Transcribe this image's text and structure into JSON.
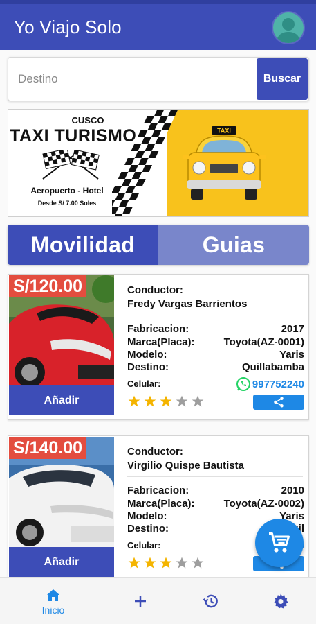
{
  "app": {
    "title": "Yo Viajo Solo"
  },
  "search": {
    "placeholder": "Destino",
    "button_label": "Buscar"
  },
  "banner": {
    "city": "CUSCO",
    "headline": "TAXI TURISMO",
    "subtitle": "Aeropuerto - Hotel",
    "price_note": "Desde S/ 7.00 Soles",
    "taxi_sign": "TAXI"
  },
  "tabs": [
    {
      "label": "Movilidad",
      "active": true
    },
    {
      "label": "Guias",
      "active": false
    }
  ],
  "labels": {
    "driver": "Conductor:",
    "year": "Fabricacion:",
    "brand": "Marca(Placa):",
    "model": "Modelo:",
    "destination": "Destino:",
    "phone": "Celular:",
    "add": "Añadir"
  },
  "listings": [
    {
      "price": "S/120.00",
      "driver": "Fredy Vargas Barrientos",
      "year": "2017",
      "brand": "Toyota(AZ-0001)",
      "model": "Yaris",
      "destination": "Quillabamba",
      "phone": "997752240",
      "rating": 3,
      "max_rating": 5
    },
    {
      "price": "S/140.00",
      "driver": "Virgilio Quispe Bautista",
      "year": "2010",
      "brand": "Toyota(AZ-0002)",
      "model": "Yaris",
      "destination": "Quil",
      "phone": "9",
      "rating": 3,
      "max_rating": 5
    }
  ],
  "bottom_nav": [
    {
      "label": "Inicio",
      "icon": "home-icon",
      "active": true
    },
    {
      "label": "",
      "icon": "plus-icon",
      "active": false
    },
    {
      "label": "",
      "icon": "history-icon",
      "active": false
    },
    {
      "label": "",
      "icon": "gear-icon",
      "active": false
    }
  ],
  "colors": {
    "primary": "#3d4db7",
    "tab_inactive": "#7986cb",
    "accent": "#1e88e5",
    "price_badge": "#e34d3f",
    "star_on": "#f4b400",
    "star_off": "#9e9e9e",
    "whatsapp": "#25d366",
    "banner_yellow": "#f8c21c"
  }
}
